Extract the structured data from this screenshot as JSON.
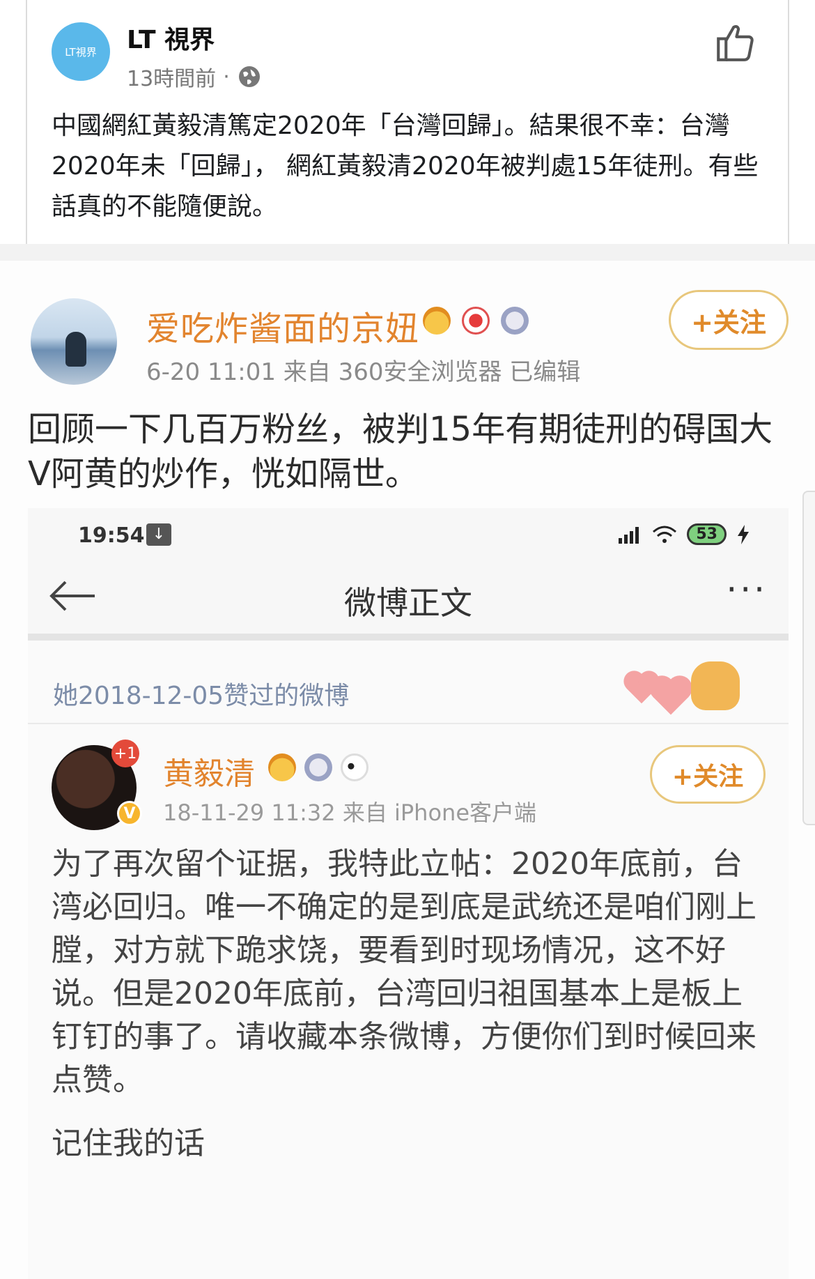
{
  "post": {
    "author_avatar_text": "LT視界",
    "author_name": "LT 視界",
    "time": "13時間前",
    "separator": "·",
    "text": "中國網紅黃毅清篤定2020年「台灣回歸」。結果很不幸：台灣2020年未「回歸」， 網紅黃毅清2020年被判處15年徒刑。有些話真的不能隨便說。"
  },
  "weibo": {
    "name": "爱吃炸酱面的京妞",
    "meta": "6-20 11:01   来自 360安全浏览器   已编辑",
    "follow_label": "+关注",
    "text": "回顾一下几百万粉丝，被判15年有期徒刑的碍国大 V阿黄的炒作，恍如隔世。"
  },
  "phone": {
    "time": "19:54",
    "battery": "53",
    "nav_title": "微博正文",
    "more": "···",
    "liked_text": "她2018-12-05赞过的微博",
    "post": {
      "plus_badge": "+1",
      "v_badge": "V",
      "name": "黄毅清",
      "meta": "18-11-29 11:32  来自 iPhone客户端",
      "follow_label": "+关注",
      "text": "为了再次留个证据，我特此立帖：2020年底前，台湾必回归。唯一不确定的是到底是武统还是咱们刚上膛，对方就下跪求饶，要看到时现场情况，这不好说。但是2020年底前，台湾回归祖国基本上是板上钉钉的事了。请收藏本条微博，方便你们到时候回来点赞。",
      "cut_text": "记住我的话"
    }
  },
  "colors": {
    "fb_avatar": "#5ab8ea",
    "weibo_name": "#e2842e",
    "follow_border": "#e8c77c",
    "liked_text": "#7c8ca8"
  }
}
